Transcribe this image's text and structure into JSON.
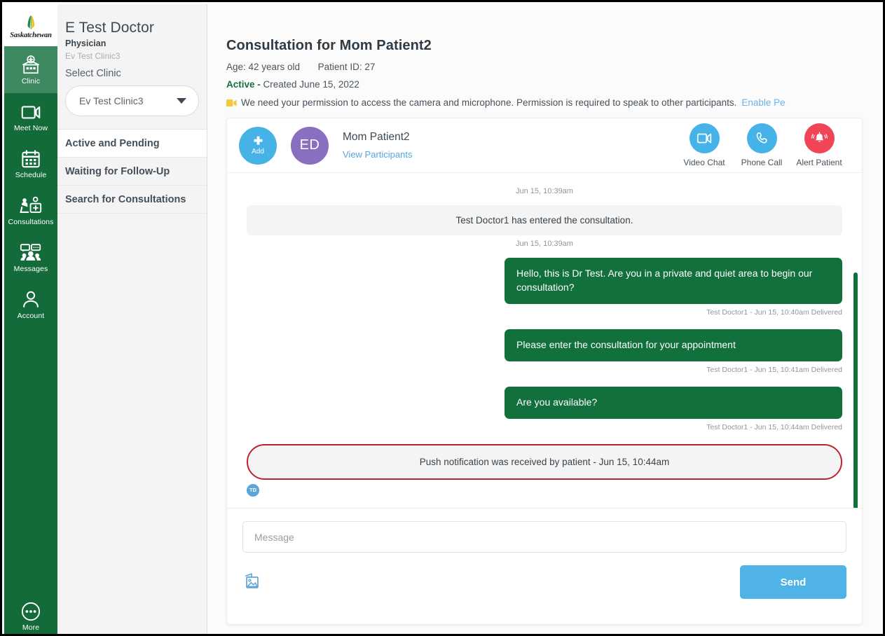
{
  "nav": {
    "logo": {
      "icon": "wheat-sheaf-icon",
      "label": "Saskatchewan"
    },
    "items": [
      {
        "label": "Clinic",
        "icon": "clinic-building-icon",
        "active": true
      },
      {
        "label": "Meet Now",
        "icon": "video-camera-icon",
        "active": false
      },
      {
        "label": "Schedule",
        "icon": "calendar-icon",
        "active": false
      },
      {
        "label": "Consultations",
        "icon": "consultation-desk-icon",
        "active": false
      },
      {
        "label": "Messages",
        "icon": "messages-group-icon",
        "active": false
      },
      {
        "label": "Account",
        "icon": "person-icon",
        "active": false
      }
    ],
    "more": {
      "label": "More",
      "icon": "ellipsis-circle-icon"
    }
  },
  "sidebar": {
    "doctor_name": "E Test Doctor",
    "doctor_role": "Physician",
    "doctor_clinic": "Ev Test Clinic3",
    "select_label": "Select Clinic",
    "clinic_selected": "Ev Test Clinic3",
    "items": [
      {
        "label": "Active and Pending",
        "selected": true
      },
      {
        "label": "Waiting for Follow-Up",
        "selected": false
      },
      {
        "label": "Search for Consultations",
        "selected": false
      }
    ]
  },
  "main": {
    "title": "Consultation for Mom Patient2",
    "age": "Age: 42 years old",
    "patient_id": "Patient ID: 27",
    "status": "Active -",
    "created": " Created June 15, 2022",
    "permission_text": "We need your permission to access the camera and microphone. Permission is required to speak to other participants.",
    "permission_link": "Enable Pe"
  },
  "card": {
    "add_label": "Add",
    "avatar_initials": "ED",
    "patient_name": "Mom Patient2",
    "view_participants": "View Participants",
    "actions": [
      {
        "label": "Video Chat",
        "icon": "video-camera-icon",
        "color": "#45b3e7"
      },
      {
        "label": "Phone Call",
        "icon": "phone-icon",
        "color": "#45b3e7"
      },
      {
        "label": "Alert Patient",
        "icon": "bell-alert-icon",
        "color": "#ef4556"
      }
    ]
  },
  "chat": {
    "timestamp_1": "Jun 15, 10:39am",
    "system_entered": "Test Doctor1 has entered the consultation.",
    "timestamp_2": "Jun 15, 10:39am",
    "messages": [
      {
        "text": "Hello, this is Dr Test.  Are you in a private and quiet area to begin our consultation?",
        "meta": "Test Doctor1 - Jun 15, 10:40am Delivered"
      },
      {
        "text": "Please enter the consultation for your appointment",
        "meta": "Test Doctor1 - Jun 15, 10:41am Delivered"
      },
      {
        "text": "Are you available?",
        "meta": "Test Doctor1 - Jun 15, 10:44am Delivered"
      }
    ],
    "push_notice": "Push notification was received by patient - Jun 15, 10:44am",
    "reader_badge": "TD"
  },
  "composer": {
    "placeholder": "Message",
    "send_label": "Send",
    "attach_icon": "image-attachment-icon"
  },
  "colors": {
    "brand_green": "#146b3a",
    "bubble_green": "#12703d",
    "accent_blue": "#45b3e7",
    "alert_red": "#ef4556",
    "push_border_red": "#bc2432",
    "avatar_purple": "#8a6fc0",
    "link_blue": "#54a6e0"
  }
}
